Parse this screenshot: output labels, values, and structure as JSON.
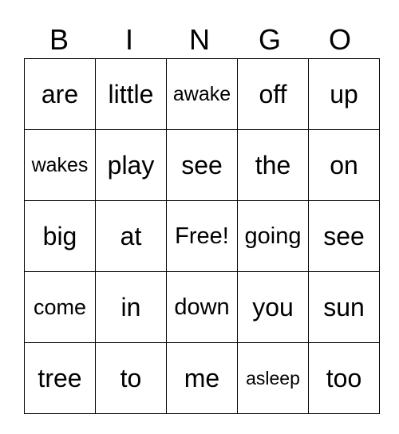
{
  "header": [
    "B",
    "I",
    "N",
    "G",
    "O"
  ],
  "cells": [
    [
      "are",
      "little",
      "awake",
      "off",
      "up"
    ],
    [
      "wakes",
      "play",
      "see",
      "the",
      "on"
    ],
    [
      "big",
      "at",
      "Free!",
      "going",
      "see"
    ],
    [
      "come",
      "in",
      "down",
      "you",
      "sun"
    ],
    [
      "tree",
      "to",
      "me",
      "asleep",
      "too"
    ]
  ]
}
